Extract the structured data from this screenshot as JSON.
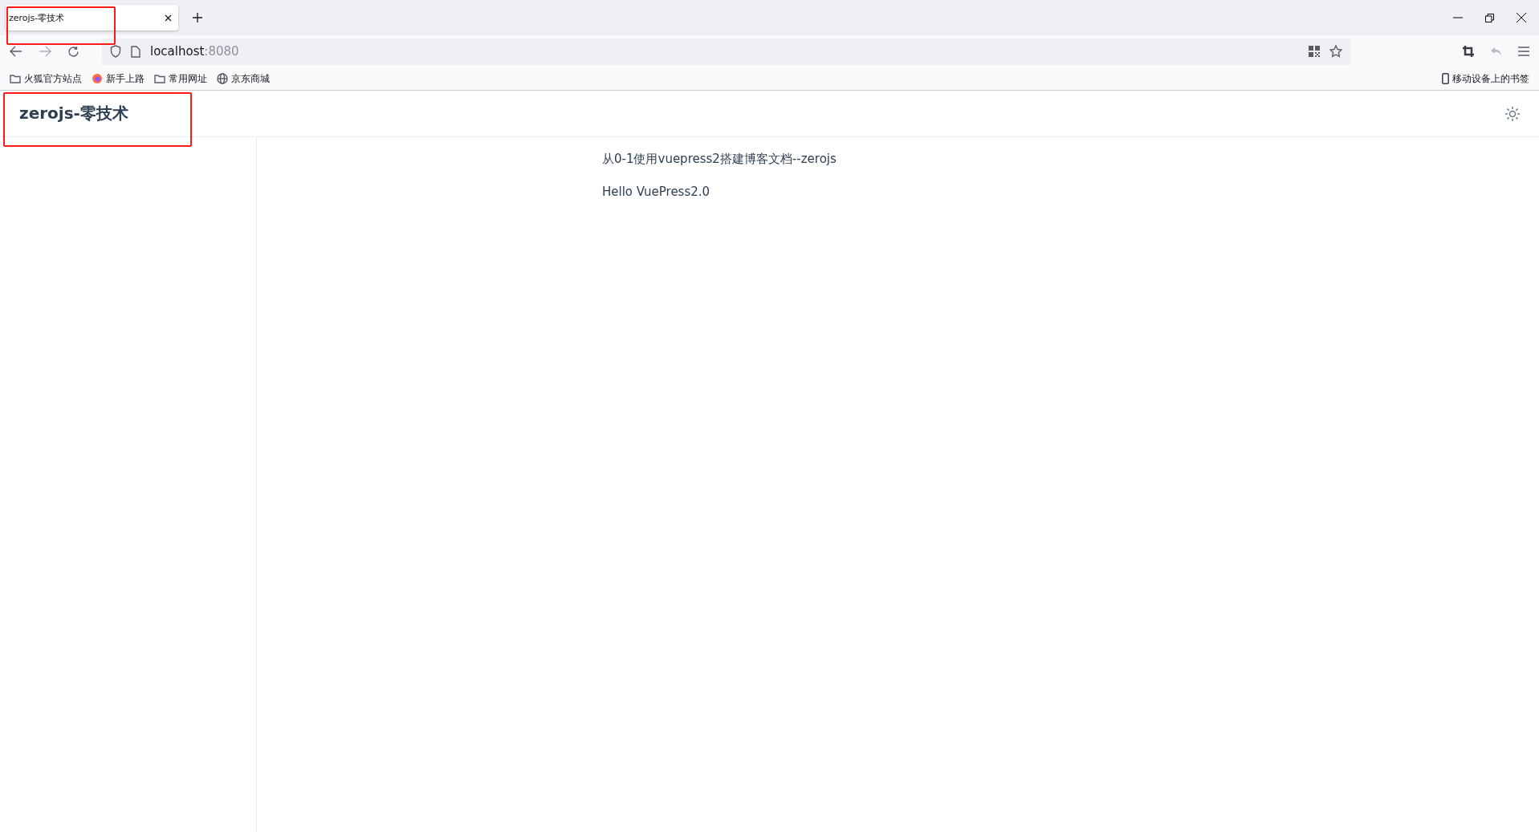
{
  "browser": {
    "tabs": [
      {
        "title": "zerojs-零技术",
        "selected": true
      }
    ],
    "address": {
      "host": "localhost",
      "port": ":8080"
    },
    "bookmarks": [
      {
        "label": "火狐官方站点",
        "kind": "folder"
      },
      {
        "label": "新手上路",
        "kind": "firefox"
      },
      {
        "label": "常用网址",
        "kind": "folder"
      },
      {
        "label": "京东商城",
        "kind": "globe"
      }
    ],
    "mobile_bookmarks": "移动设备上的书签"
  },
  "site": {
    "title": "zerojs-零技术",
    "paragraphs": [
      "从0-1使用vuepress2搭建博客文档--zerojs",
      "Hello VuePress2.0"
    ]
  }
}
